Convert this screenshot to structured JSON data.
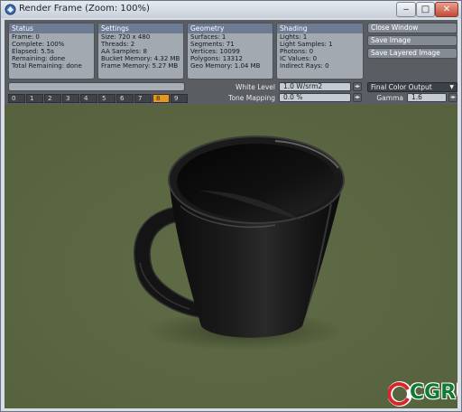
{
  "window": {
    "title": "Render Frame (Zoom: 100%)",
    "min_label": "‒",
    "max_label": "□",
    "close_label": "✕"
  },
  "status": {
    "header": "Status",
    "lines": [
      "Frame: 0",
      "Complete: 100%",
      "Elapsed: 5.5s",
      "Remaining: done",
      "Total Remaining: done"
    ]
  },
  "settings": {
    "header": "Settings",
    "lines": [
      "Size: 720 x 480",
      "Threads: 2",
      "AA Samples: 8",
      "Bucket Memory: 4.32 MB",
      "Frame Memory: 5.27 MB"
    ]
  },
  "geometry": {
    "header": "Geometry",
    "lines": [
      "Surfaces: 1",
      "Segments: 71",
      "Vertices: 10099",
      "Polygons: 13312",
      "Geo Memory: 1.04 MB"
    ]
  },
  "shading": {
    "header": "Shading",
    "lines": [
      "Lights: 1",
      "Light Samples: 1",
      "Photons: 0",
      "IC Values: 0",
      "Indirect Rays: 0"
    ]
  },
  "actions": {
    "close_window": "Close Window",
    "save_image": "Save Image",
    "save_layered": "Save Layered Image"
  },
  "progress": {
    "complete_fraction": 1.0
  },
  "frames": {
    "items": [
      "0",
      "1",
      "2",
      "3",
      "4",
      "5",
      "6",
      "7",
      "8",
      "9"
    ],
    "active_index": 8
  },
  "controls": {
    "white_level_label": "White Level",
    "white_level_value": "1.0 W/srm2",
    "tone_mapping_label": "Tone Mapping",
    "tone_mapping_value": "0.0 %",
    "output_select": "Final Color Output",
    "gamma_label": "Gamma",
    "gamma_value": "1.6"
  },
  "logo": {
    "text": "CGRU"
  },
  "colors": {
    "viewport_bg": "#5b6842",
    "active_frame": "#e4981e",
    "header_blue": "#6d7c92"
  }
}
